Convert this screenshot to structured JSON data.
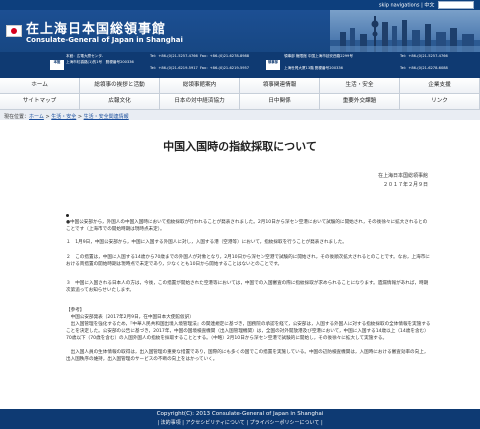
{
  "topbar": {
    "skip_nav": "skip navigations",
    "lang": "中文",
    "search_placeholder": ""
  },
  "header": {
    "title_jp": "在上海日本国総領事館",
    "title_en": "Consulate-General of Japan in Shanghai"
  },
  "contact": {
    "main_tag": "本館",
    "main_addr": "本館：広電大廈センタ-",
    "main_addr2": "上海市虹橋路(1)的1号　郵便番号200336",
    "main_tel1": "Tel：+86-(0)21-5257-4766",
    "main_fax1": "Fax：+86-(0)21-6278-8988",
    "main_tel2": "Tel：+86-(0)21-6219-5917",
    "main_fax2": "Fax：+86-(0)21-6219-5957",
    "annex_tag": "領事部",
    "annex_addr": "領事部  権限館 中国上海市延安西路2299号",
    "annex_tel1": "Tel：+86-(0)21-5257-4766",
    "annex_addr2": "上海世貿大厦13階 郵便番号200336",
    "annex_tel2": "Tel：+86-(0)21-6278-6088"
  },
  "nav": {
    "row1": [
      "ホーム",
      "総領事の挨拶と活動",
      "総領事館案内",
      "領事関連情報",
      "生活・安全",
      "企業支援"
    ],
    "row2": [
      "サイトマップ",
      "広報文化",
      "日本の対中経済協力",
      "日中関係",
      "重要外交課題",
      "リンク"
    ]
  },
  "breadcrumb": {
    "prefix": "現在位置：",
    "home": "ホーム",
    "sep": " > ",
    "level2": "生活・安全",
    "level3": "生活・安全関連情報"
  },
  "article": {
    "title": "中国入国時の指紋採取について",
    "sig_org": "在上海日本国総領事館",
    "sig_date": "２０１７年２月９日",
    "p1": "●中国公安部から，外国人の中国入国時において指紋採取が行われることが発表されました。2月10日から深セン空港において試験的に開始され，その後徐々に拡大されるとのことです（上海市での開始時期は現時点未定）。",
    "p2": "１　1月9日，中国公安部から，中国に入国する外国人に対し，入国する港（空港等）において，指紋採取を行うことが発表されました。",
    "p3": "２　この措置は，中国に入国する14歳から70歳までの外国人が対象となり，2月10日から深セン空港で試験的に開始され，その後順次拡大されるとのことです。なお，上海市における両措置の開始時期は現時点で未定であり，少なくとも10日から開始することはないとのことです。",
    "p4": "３　中国に入国される日本人の方は，今後，この措置が開始された空港等においては，中国での入国審査の際に指紋採取が求められることになります。遺漏情報があれば，時期次第追ってお知らせいたします。",
    "ref_head": "【参考】",
    "ref1": "　中国公安部発表（2017年2月9日，在中国日本大使館仮訳）",
    "ref2": "　出入国管理を強化するため，『中華人民共和国出境入境管理法』の関連規定に基づき，国務院の承認を経て，公安部は，入国する外国人に対する指紋採取の全体情報を実施することを決定した。公安部の公告に基づき，2017年，中国の国境検査機関（出入国管理機関）は，全国の対外開放港及び空港において，中国に入国する14歳以上（14歳を含む）70歳以下（70歳を含む）の入国外国人の指紋を採取することとする。（中略）2月10日から深セン空港で試験的に開始し，その後徐々に拡大して実施する。",
    "ref3": "　出入国人員の生体情報の取得は，出入国管理の重要な措置であり，国際的にも多くの国でこの措置を実施している。中国の辺防検査機関は，入国時における審査効率の向上，出入国秩序の維持，出入国管理のサービスの不断の向上をはかっていく。"
  },
  "footer": {
    "copyright": "Copyright(C): 2013 Consulate-General of Japan in Shanghai",
    "links": "| 法的事項 | アクセシビリティについて | プライバシーポリシーについて |"
  },
  "colors": {
    "header_blue": "#1c4f93",
    "footer_blue": "#0e3a73",
    "link": "#1a4e9c"
  }
}
